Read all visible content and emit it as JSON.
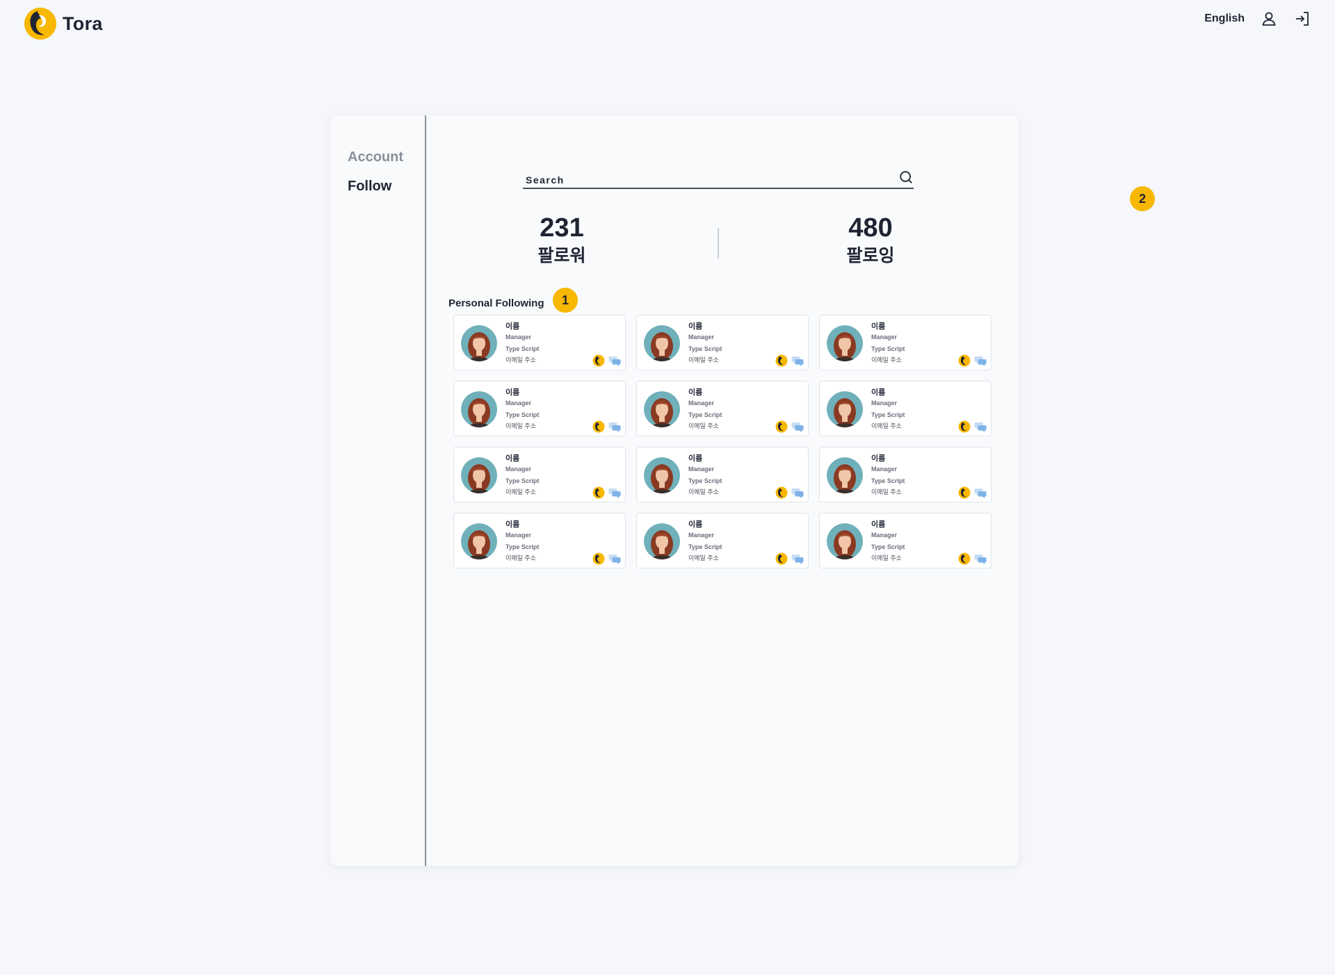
{
  "header": {
    "brand": "Tora",
    "language": "English",
    "icons": [
      "user-icon",
      "login-icon"
    ]
  },
  "sidebar": {
    "items": [
      {
        "label": "Account",
        "active": false
      },
      {
        "label": "Follow",
        "active": true
      }
    ]
  },
  "search": {
    "placeholder": "Search"
  },
  "stats": {
    "followers": {
      "count": "231",
      "label": "팔로워"
    },
    "following": {
      "count": "480",
      "label": "팔로잉"
    }
  },
  "section": {
    "title": "Personal Following"
  },
  "badges": [
    "1",
    "2"
  ],
  "cards": [
    {
      "name": "이름",
      "role": "Manager",
      "skill": "Type Script",
      "email": "이메일 주소"
    },
    {
      "name": "이름",
      "role": "Manager",
      "skill": "Type Script",
      "email": "이메일 주소"
    },
    {
      "name": "이름",
      "role": "Manager",
      "skill": "Type Script",
      "email": "이메일 주소"
    },
    {
      "name": "이름",
      "role": "Manager",
      "skill": "Type Script",
      "email": "이메일 주소"
    },
    {
      "name": "이름",
      "role": "Manager",
      "skill": "Type Script",
      "email": "이메일 주소"
    },
    {
      "name": "이름",
      "role": "Manager",
      "skill": "Type Script",
      "email": "이메일 주소"
    },
    {
      "name": "이름",
      "role": "Manager",
      "skill": "Type Script",
      "email": "이메일 주소"
    },
    {
      "name": "이름",
      "role": "Manager",
      "skill": "Type Script",
      "email": "이메일 주소"
    },
    {
      "name": "이름",
      "role": "Manager",
      "skill": "Type Script",
      "email": "이메일 주소"
    },
    {
      "name": "이름",
      "role": "Manager",
      "skill": "Type Script",
      "email": "이메일 주소"
    },
    {
      "name": "이름",
      "role": "Manager",
      "skill": "Type Script",
      "email": "이메일 주소"
    },
    {
      "name": "이름",
      "role": "Manager",
      "skill": "Type Script",
      "email": "이메일 주소"
    }
  ],
  "colors": {
    "accent": "#f8b700",
    "text": "#1f2433",
    "muted": "#8a8f9a",
    "background": "#f5f7fb",
    "chat": "#7fb3e8"
  }
}
